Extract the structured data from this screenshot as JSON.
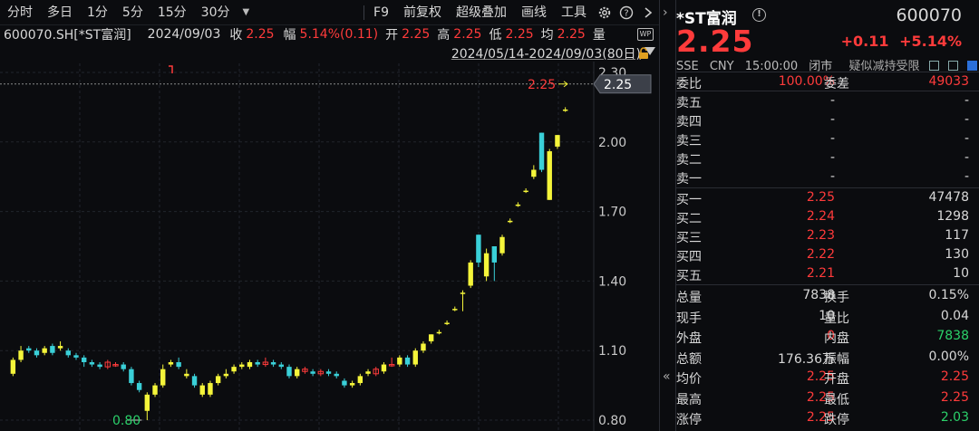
{
  "toolbar": {
    "periods": [
      "分时",
      "多日",
      "1分",
      "5分",
      "15分",
      "30分"
    ],
    "tools": [
      "F9",
      "前复权",
      "超级叠加",
      "画线",
      "工具"
    ]
  },
  "infobar": {
    "code_name": "600070.SH[*ST富润]",
    "date": "2024/09/03",
    "close_label": "收",
    "close": "2.25",
    "amp_label": "幅",
    "amp": "5.14%(0.11)",
    "open_label": "开",
    "open": "2.25",
    "high_label": "高",
    "high": "2.25",
    "low_label": "低",
    "low": "2.25",
    "avg_label": "均",
    "avg": "2.25",
    "vol_label": "量"
  },
  "range": {
    "text": "2024/05/14-2024/09/03(80日)"
  },
  "chart_data": {
    "type": "candlestick",
    "y_ticks": [
      "2.30",
      "2.00",
      "1.70",
      "1.40",
      "1.10",
      "0.80"
    ],
    "ylim": [
      0.77,
      2.33
    ],
    "last_price_label": "2.25",
    "last_price_tag": "2.25",
    "low_marker": "0.80",
    "candles": [
      {
        "o": 1.0,
        "c": 1.06,
        "h": 1.07,
        "l": 0.99,
        "d": "up"
      },
      {
        "o": 1.06,
        "c": 1.1,
        "h": 1.12,
        "l": 1.05,
        "d": "up"
      },
      {
        "o": 1.11,
        "c": 1.1,
        "h": 1.12,
        "l": 1.09,
        "d": "dn"
      },
      {
        "o": 1.1,
        "c": 1.08,
        "h": 1.11,
        "l": 1.07,
        "d": "dn"
      },
      {
        "o": 1.09,
        "c": 1.11,
        "h": 1.12,
        "l": 1.08,
        "d": "up"
      },
      {
        "o": 1.12,
        "c": 1.09,
        "h": 1.13,
        "l": 1.08,
        "d": "dn"
      },
      {
        "o": 1.11,
        "c": 1.12,
        "h": 1.14,
        "l": 1.1,
        "d": "up"
      },
      {
        "o": 1.1,
        "c": 1.08,
        "h": 1.11,
        "l": 1.07,
        "d": "dn"
      },
      {
        "o": 1.08,
        "c": 1.07,
        "h": 1.09,
        "l": 1.06,
        "d": "dn"
      },
      {
        "o": 1.07,
        "c": 1.05,
        "h": 1.08,
        "l": 1.03,
        "d": "dn"
      },
      {
        "o": 1.05,
        "c": 1.04,
        "h": 1.06,
        "l": 1.03,
        "d": "dn"
      },
      {
        "o": 1.04,
        "c": 1.03,
        "h": 1.05,
        "l": 1.02,
        "d": "dn"
      },
      {
        "o": 1.03,
        "c": 1.05,
        "h": 1.06,
        "l": 1.02,
        "d": "red"
      },
      {
        "o": 1.04,
        "c": 1.04,
        "h": 1.05,
        "l": 1.03,
        "d": "red"
      },
      {
        "o": 1.04,
        "c": 1.02,
        "h": 1.05,
        "l": 1.01,
        "d": "dn"
      },
      {
        "o": 1.02,
        "c": 0.96,
        "h": 1.03,
        "l": 0.95,
        "d": "dn"
      },
      {
        "o": 0.96,
        "c": 0.93,
        "h": 0.97,
        "l": 0.92,
        "d": "dn"
      },
      {
        "o": 0.84,
        "c": 0.91,
        "h": 0.92,
        "l": 0.8,
        "d": "up"
      },
      {
        "o": 0.91,
        "c": 0.95,
        "h": 0.96,
        "l": 0.9,
        "d": "up"
      },
      {
        "o": 0.95,
        "c": 1.02,
        "h": 1.04,
        "l": 0.94,
        "d": "up"
      },
      {
        "o": 1.04,
        "c": 1.05,
        "h": 1.06,
        "l": 1.03,
        "d": "up"
      },
      {
        "o": 1.05,
        "c": 1.03,
        "h": 1.07,
        "l": 1.02,
        "d": "dn"
      },
      {
        "o": 1.0,
        "c": 0.99,
        "h": 1.02,
        "l": 0.98,
        "d": "up"
      },
      {
        "o": 0.99,
        "c": 0.95,
        "h": 1.0,
        "l": 0.94,
        "d": "dn"
      },
      {
        "o": 0.95,
        "c": 0.91,
        "h": 0.96,
        "l": 0.9,
        "d": "up"
      },
      {
        "o": 0.91,
        "c": 0.96,
        "h": 0.97,
        "l": 0.9,
        "d": "up"
      },
      {
        "o": 0.96,
        "c": 0.99,
        "h": 1.0,
        "l": 0.95,
        "d": "up"
      },
      {
        "o": 0.99,
        "c": 1.0,
        "h": 1.02,
        "l": 0.98,
        "d": "up"
      },
      {
        "o": 1.01,
        "c": 1.03,
        "h": 1.04,
        "l": 1.0,
        "d": "up"
      },
      {
        "o": 1.03,
        "c": 1.04,
        "h": 1.05,
        "l": 1.02,
        "d": "up"
      },
      {
        "o": 1.03,
        "c": 1.05,
        "h": 1.06,
        "l": 1.02,
        "d": "up"
      },
      {
        "o": 1.05,
        "c": 1.04,
        "h": 1.06,
        "l": 1.03,
        "d": "dn"
      },
      {
        "o": 1.04,
        "c": 1.05,
        "h": 1.07,
        "l": 1.03,
        "d": "red"
      },
      {
        "o": 1.05,
        "c": 1.04,
        "h": 1.06,
        "l": 1.03,
        "d": "dn"
      },
      {
        "o": 1.04,
        "c": 1.03,
        "h": 1.05,
        "l": 1.02,
        "d": "dn"
      },
      {
        "o": 1.03,
        "c": 0.99,
        "h": 1.04,
        "l": 0.98,
        "d": "dn"
      },
      {
        "o": 0.99,
        "c": 1.02,
        "h": 1.03,
        "l": 0.98,
        "d": "up"
      },
      {
        "o": 1.02,
        "c": 1.01,
        "h": 1.03,
        "l": 1.0,
        "d": "red"
      },
      {
        "o": 1.01,
        "c": 1.0,
        "h": 1.02,
        "l": 0.99,
        "d": "dn"
      },
      {
        "o": 1.0,
        "c": 1.01,
        "h": 1.02,
        "l": 0.99,
        "d": "red"
      },
      {
        "o": 1.01,
        "c": 1.0,
        "h": 1.02,
        "l": 0.99,
        "d": "dn"
      },
      {
        "o": 1.0,
        "c": 0.99,
        "h": 1.01,
        "l": 0.98,
        "d": "dn"
      },
      {
        "o": 0.97,
        "c": 0.95,
        "h": 0.98,
        "l": 0.94,
        "d": "dn"
      },
      {
        "o": 0.95,
        "c": 0.96,
        "h": 0.97,
        "l": 0.94,
        "d": "up"
      },
      {
        "o": 0.96,
        "c": 0.99,
        "h": 1.0,
        "l": 0.95,
        "d": "up"
      },
      {
        "o": 1.0,
        "c": 1.01,
        "h": 1.02,
        "l": 0.99,
        "d": "up"
      },
      {
        "o": 1.0,
        "c": 1.02,
        "h": 1.03,
        "l": 0.99,
        "d": "red"
      },
      {
        "o": 1.01,
        "c": 1.04,
        "h": 1.05,
        "l": 1.0,
        "d": "up"
      },
      {
        "o": 1.04,
        "c": 1.04,
        "h": 1.07,
        "l": 1.03,
        "d": "red"
      },
      {
        "o": 1.04,
        "c": 1.07,
        "h": 1.08,
        "l": 1.03,
        "d": "up"
      },
      {
        "o": 1.07,
        "c": 1.04,
        "h": 1.08,
        "l": 1.03,
        "d": "dn"
      },
      {
        "o": 1.04,
        "c": 1.1,
        "h": 1.11,
        "l": 1.03,
        "d": "up"
      },
      {
        "o": 1.1,
        "c": 1.13,
        "h": 1.14,
        "l": 1.09,
        "d": "up"
      },
      {
        "o": 1.14,
        "c": 1.17,
        "h": 1.17,
        "l": 1.13,
        "d": "up"
      },
      {
        "o": 1.18,
        "c": 1.18,
        "h": 1.19,
        "l": 1.17,
        "d": "up"
      },
      {
        "o": 1.22,
        "c": 1.22,
        "h": 1.23,
        "l": 1.21,
        "d": "up"
      },
      {
        "o": 1.28,
        "c": 1.28,
        "h": 1.29,
        "l": 1.27,
        "d": "up"
      },
      {
        "o": 1.35,
        "c": 1.35,
        "h": 1.36,
        "l": 1.27,
        "d": "up"
      },
      {
        "o": 1.38,
        "c": 1.48,
        "h": 1.49,
        "l": 1.37,
        "d": "up"
      },
      {
        "o": 1.6,
        "c": 1.48,
        "h": 1.6,
        "l": 1.46,
        "d": "dn"
      },
      {
        "o": 1.42,
        "c": 1.52,
        "h": 1.54,
        "l": 1.4,
        "d": "up"
      },
      {
        "o": 1.55,
        "c": 1.48,
        "h": 1.55,
        "l": 1.4,
        "d": "dn"
      },
      {
        "o": 1.52,
        "c": 1.59,
        "h": 1.6,
        "l": 1.51,
        "d": "up"
      },
      {
        "o": 1.66,
        "c": 1.66,
        "h": 1.67,
        "l": 1.65,
        "d": "up"
      },
      {
        "o": 1.73,
        "c": 1.73,
        "h": 1.74,
        "l": 1.72,
        "d": "up"
      },
      {
        "o": 1.79,
        "c": 1.79,
        "h": 1.8,
        "l": 1.78,
        "d": "up"
      },
      {
        "o": 1.85,
        "c": 1.88,
        "h": 1.9,
        "l": 1.84,
        "d": "up"
      },
      {
        "o": 2.04,
        "c": 1.88,
        "h": 2.04,
        "l": 1.87,
        "d": "dn"
      },
      {
        "o": 1.75,
        "c": 1.96,
        "h": 1.97,
        "l": 1.75,
        "d": "up"
      },
      {
        "o": 1.98,
        "c": 2.03,
        "h": 2.03,
        "l": 1.97,
        "d": "up"
      },
      {
        "o": 2.14,
        "c": 2.14,
        "h": 2.15,
        "l": 2.13,
        "d": "up"
      }
    ]
  },
  "quote": {
    "name": "*ST富润",
    "code": "600070",
    "price": "2.25",
    "change": "+0.11",
    "change_pct": "+5.14%",
    "exchange": "SSE",
    "currency": "CNY",
    "time": "15:00:00",
    "status": "闭市",
    "risk": "疑似减持受限"
  },
  "ratio": {
    "wb_label": "委比",
    "wb_value": "100.00%",
    "wc_label": "委差",
    "wc_value": "49033"
  },
  "asks": [
    {
      "label": "卖五",
      "price": "-",
      "vol": "-"
    },
    {
      "label": "卖四",
      "price": "-",
      "vol": "-"
    },
    {
      "label": "卖三",
      "price": "-",
      "vol": "-"
    },
    {
      "label": "卖二",
      "price": "-",
      "vol": "-"
    },
    {
      "label": "卖一",
      "price": "-",
      "vol": "-"
    }
  ],
  "bids": [
    {
      "label": "买一",
      "price": "2.25",
      "vol": "47478"
    },
    {
      "label": "买二",
      "price": "2.24",
      "vol": "1298"
    },
    {
      "label": "买三",
      "price": "2.23",
      "vol": "117"
    },
    {
      "label": "买四",
      "price": "2.22",
      "vol": "130"
    },
    {
      "label": "买五",
      "price": "2.21",
      "vol": "10"
    }
  ],
  "stats": [
    {
      "l1": "总量",
      "v1": "7838",
      "c1": "white",
      "l2": "换手",
      "v2": "0.15%",
      "c2": "white"
    },
    {
      "l1": "现手",
      "v1": "10",
      "c1": "white",
      "l2": "量比",
      "v2": "0.04",
      "c2": "white"
    },
    {
      "l1": "外盘",
      "v1": "0",
      "c1": "red",
      "l2": "内盘",
      "v2": "7838",
      "c2": "green"
    },
    {
      "l1": "总额",
      "v1": "176.36万",
      "c1": "white",
      "l2": "振幅",
      "v2": "0.00%",
      "c2": "white"
    },
    {
      "l1": "均价",
      "v1": "2.25",
      "c1": "red",
      "l2": "开盘",
      "v2": "2.25",
      "c2": "red"
    },
    {
      "l1": "最高",
      "v1": "2.25",
      "c1": "red",
      "l2": "最低",
      "v2": "2.25",
      "c2": "red"
    },
    {
      "l1": "涨停",
      "v1": "2.25",
      "c1": "red",
      "l2": "跌停",
      "v2": "2.03",
      "c2": "green"
    }
  ],
  "colors": {
    "up": "#f5f53a",
    "down": "#3ad0d8",
    "red": "#ff3b3b",
    "green": "#2bd16a"
  }
}
